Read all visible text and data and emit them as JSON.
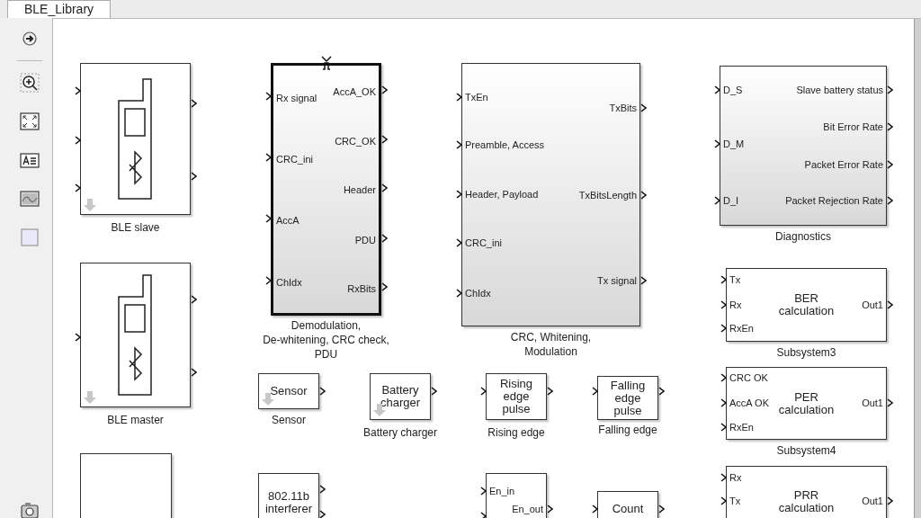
{
  "tab": {
    "label": "BLE_Library",
    "selected": true
  },
  "blocks": [
    {
      "kind": "phone",
      "caption": "BLE slave",
      "gradient": false,
      "thick": false,
      "library_link": true,
      "trigger": false
    },
    {
      "kind": "ports",
      "caption": "Demodulation,\nDe-whitening, CRC check,\nPDU",
      "gradient": true,
      "thick": true,
      "library_link": false,
      "trigger": true,
      "inputs": [
        "Rx signal",
        "CRC_ini",
        "AccA",
        "ChIdx"
      ],
      "outputs": [
        "AccA_OK",
        "CRC_OK",
        "Header",
        "PDU",
        "RxBits"
      ]
    },
    {
      "kind": "ports",
      "caption": "CRC, Whitening,\nModulation",
      "gradient": true,
      "thick": false,
      "library_link": false,
      "trigger": false,
      "inputs": [
        "TxEn",
        "Preamble, Access",
        "Header, Payload",
        "CRC_ini",
        "ChIdx"
      ],
      "outputs": [
        "TxBits",
        "TxBitsLength",
        "Tx signal"
      ]
    },
    {
      "kind": "ports",
      "caption": "Diagnostics",
      "gradient": true,
      "thick": false,
      "library_link": false,
      "trigger": false,
      "inputs": [
        "D_S",
        "D_M",
        "D_I"
      ],
      "outputs": [
        "Slave battery status",
        "Bit Error Rate",
        "Packet Error Rate",
        "Packet Rejection Rate"
      ]
    },
    {
      "kind": "ports",
      "caption": "Subsystem3",
      "inner": "BER\ncalculation",
      "gradient": false,
      "thick": false,
      "library_link": false,
      "trigger": false,
      "inputs": [
        "Tx",
        "Rx",
        "RxEn"
      ],
      "outputs": [
        "Out1"
      ]
    },
    {
      "kind": "phone",
      "caption": "BLE master",
      "gradient": false,
      "thick": false,
      "library_link": true,
      "trigger": false
    },
    {
      "kind": "ports",
      "caption": "Sensor",
      "inner": "Sensor",
      "gradient": false,
      "thick": false,
      "library_link": true,
      "trigger": false
    },
    {
      "kind": "ports",
      "caption": "Battery charger",
      "inner": "Battery\ncharger",
      "gradient": false,
      "thick": false,
      "library_link": true,
      "trigger": false
    },
    {
      "kind": "ports",
      "caption": "Rising edge",
      "inner": "Rising\nedge\npulse",
      "gradient": false,
      "thick": false,
      "library_link": false,
      "trigger": false
    },
    {
      "kind": "ports",
      "caption": "Falling edge",
      "inner": "Falling\nedge\npulse",
      "gradient": false,
      "thick": false,
      "library_link": false,
      "trigger": false
    },
    {
      "kind": "ports",
      "caption": "Subsystem4",
      "inner": "PER\ncalculation",
      "gradient": false,
      "thick": false,
      "library_link": false,
      "trigger": false,
      "inputs": [
        "CRC OK",
        "AccA OK",
        "RxEn"
      ],
      "outputs": [
        "Out1"
      ]
    },
    {
      "kind": "blank",
      "gradient": false,
      "thick": false,
      "library_link": false,
      "trigger": false
    },
    {
      "kind": "ports",
      "inner": "802.11b\ninterferer",
      "gradient": false,
      "thick": false,
      "library_link": false,
      "trigger": false
    },
    {
      "kind": "ports",
      "gradient": false,
      "thick": false,
      "library_link": false,
      "trigger": false,
      "inputs": [
        "En_in"
      ],
      "outputs": [
        "En_out"
      ]
    },
    {
      "kind": "ports",
      "inner": "Count",
      "gradient": false,
      "thick": false,
      "library_link": false,
      "trigger": false
    },
    {
      "kind": "ports",
      "inner": "PRR\ncalculation",
      "gradient": false,
      "thick": false,
      "library_link": false,
      "trigger": false,
      "inputs": [
        "Rx",
        "Tx"
      ],
      "outputs": [
        "Out1"
      ]
    }
  ]
}
